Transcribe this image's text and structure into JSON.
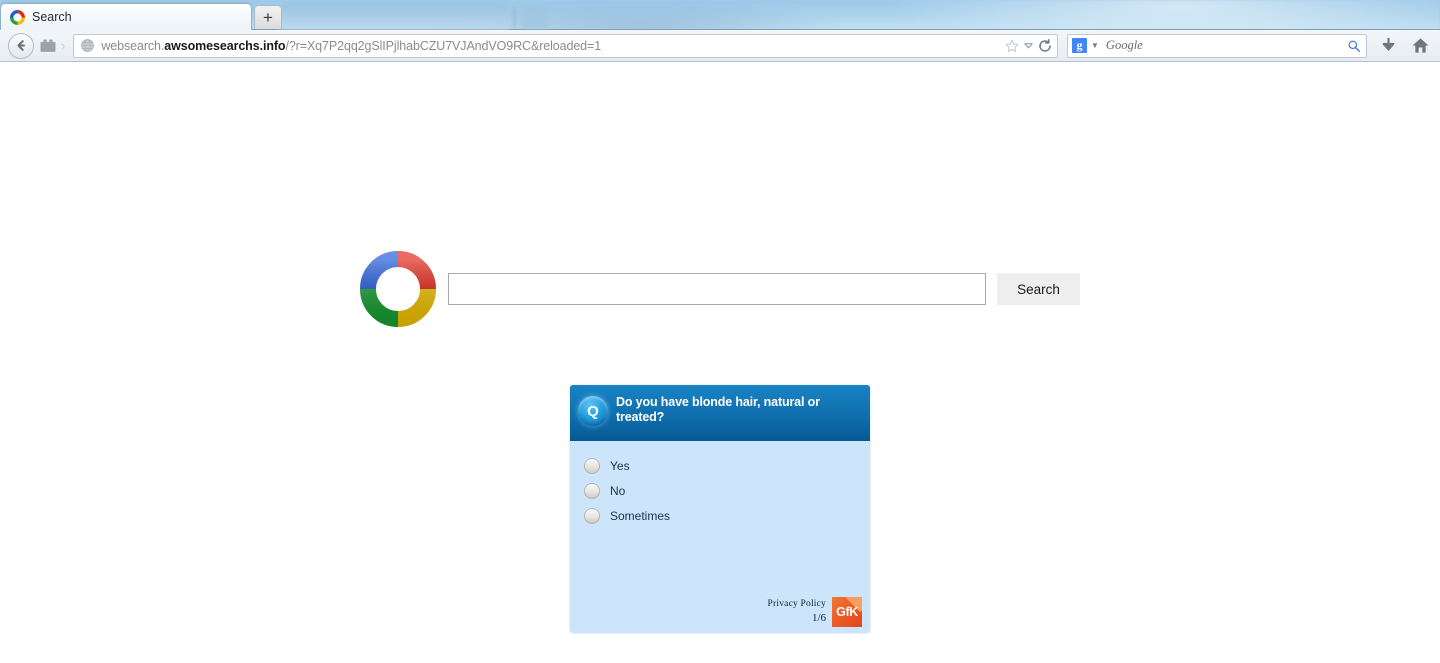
{
  "browser": {
    "tabs": [
      {
        "label": "Search",
        "favicon": "colored-ring-icon",
        "active": true
      },
      {
        "label": "",
        "favicon": "",
        "active": false,
        "blurred": true
      }
    ],
    "new_tab_label": "+",
    "toolbar": {
      "back_icon": "back-arrow-icon",
      "site_icon": "site-folder-icon",
      "breadcrumb_chevron": "›",
      "url_favicon": "globe-icon",
      "url_prefix": "websearch.",
      "url_domain": "awsomesearchs.info",
      "url_suffix": "/?r=Xq7P2qq2gSlIPjlhabCZU7VJAndVO9RC&reloaded=1",
      "bookmark_icon": "star-icon",
      "dropdown_icon": "chevron-down-icon",
      "reload_icon": "reload-icon",
      "download_icon": "download-arrow-icon",
      "home_icon": "home-icon"
    },
    "search_box": {
      "engine_badge": "g",
      "engine_name": "Google",
      "caret_icon": "chevron-down-icon",
      "magnifier_icon": "magnifier-icon"
    }
  },
  "page": {
    "logo": "colored-ring-logo",
    "search_input_value": "",
    "search_input_placeholder": "",
    "search_button_label": "Search"
  },
  "survey": {
    "badge_letter": "Q",
    "question": "Do you have blonde hair, natural or treated?",
    "options": [
      {
        "label": "Yes",
        "selected": false
      },
      {
        "label": "No",
        "selected": false
      },
      {
        "label": "Sometimes",
        "selected": false
      }
    ],
    "privacy_link": "Privacy Policy",
    "progress": "1/6",
    "brand_logo_text": "GfK",
    "colors": {
      "header_top": "#1a84c4",
      "header_bottom": "#075a93",
      "body_bg": "#cce5fa",
      "brand_orange": "#ec5b26"
    }
  }
}
